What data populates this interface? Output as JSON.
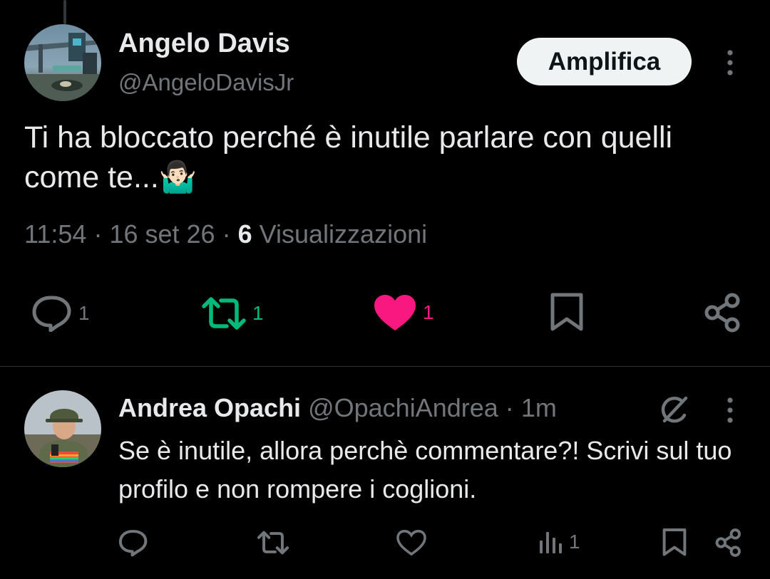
{
  "main_tweet": {
    "author_name": "Angelo Davis",
    "author_handle": "@AngeloDavisJr",
    "follow_button_label": "Amplifica",
    "text": "Ti ha bloccato perché è inutile parlare con quelli come te...🤷🏻‍♂️",
    "time": "11:54",
    "date": "16 set 26",
    "views_count": "6",
    "views_label": "Visualizzazioni",
    "separator": "·",
    "actions": {
      "reply_count": "1",
      "retweet_count": "1",
      "like_count": "1"
    },
    "icons": [
      "reply-icon",
      "retweet-icon",
      "like-icon-filled",
      "bookmark-icon",
      "share-icon",
      "more-options-icon"
    ]
  },
  "reply_tweet": {
    "author_name": "Andrea Opachi",
    "author_handle": "@OpachiAndrea",
    "time_ago": "1m",
    "separator": "·",
    "text": "Se è inutile, allora perchè commentare?! Scrivi sul tuo profilo e non rompere i coglioni.",
    "actions": {
      "views_count": "1"
    },
    "icons": [
      "reply-icon",
      "retweet-icon",
      "like-icon",
      "views-icon",
      "bookmark-icon",
      "share-icon",
      "grok-icon",
      "more-options-icon"
    ]
  },
  "colors": {
    "background": "#000000",
    "text": "#e7e9ea",
    "muted": "#71767b",
    "retweet_active": "#00ba7c",
    "like_active": "#f91880",
    "follow_button_bg": "#eff3f4"
  }
}
